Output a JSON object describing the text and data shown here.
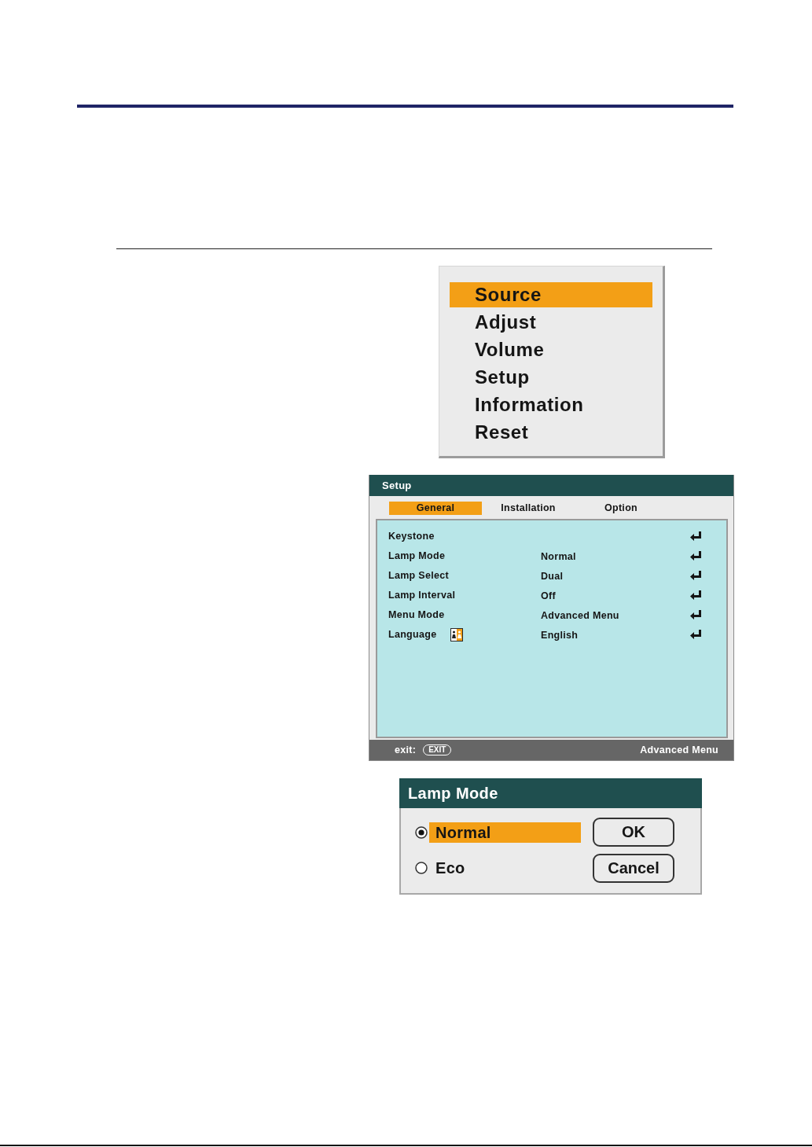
{
  "main_menu": {
    "items": [
      {
        "label": "Source",
        "selected": true
      },
      {
        "label": "Adjust",
        "selected": false
      },
      {
        "label": "Volume",
        "selected": false
      },
      {
        "label": "Setup",
        "selected": false
      },
      {
        "label": "Information",
        "selected": false
      },
      {
        "label": "Reset",
        "selected": false
      }
    ]
  },
  "setup_window": {
    "title": "Setup",
    "tabs": [
      {
        "label": "General",
        "selected": true
      },
      {
        "label": "Installation",
        "selected": false
      },
      {
        "label": "Option",
        "selected": false
      }
    ],
    "rows": [
      {
        "kind": "plain",
        "label": "Keystone"
      },
      {
        "kind": "plain",
        "label": "Lamp Mode",
        "value": "Normal"
      },
      {
        "kind": "plain",
        "label": "Lamp Select",
        "value": "Dual"
      },
      {
        "kind": "plain",
        "label": "Lamp Interval",
        "value": "Off"
      },
      {
        "kind": "plain",
        "label": "Menu Mode",
        "value": "Advanced Menu"
      },
      {
        "kind": "icon",
        "label": "Language",
        "value": "English"
      }
    ],
    "footer": {
      "exit_label": "exit:",
      "exit_key": "EXIT",
      "mode": "Advanced Menu"
    }
  },
  "lamp_mode_dialog": {
    "title": "Lamp Mode",
    "options": [
      {
        "label": "Normal",
        "checked": true,
        "selected": true
      },
      {
        "label": "Eco",
        "checked": false,
        "selected": false
      }
    ],
    "buttons": [
      "OK",
      "Cancel"
    ]
  }
}
